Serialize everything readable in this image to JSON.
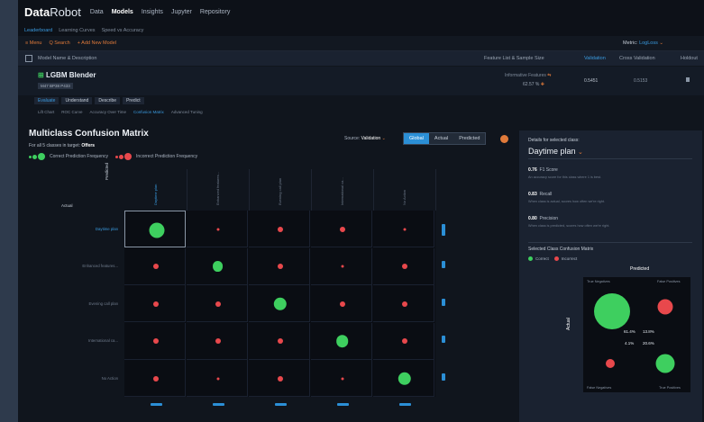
{
  "app": {
    "logo_data": "Data",
    "logo_robot": "Robot",
    "nav": [
      "Data",
      "Models",
      "Insights",
      "Jupyter",
      "Repository"
    ],
    "active_nav": "Models"
  },
  "subnav": [
    "Leaderboard",
    "Learning Curves",
    "Speed vs Accuracy"
  ],
  "actions": {
    "menu": "≡ Menu",
    "search": "Q Search",
    "add": "+ Add New Model",
    "metric_label": "Metric",
    "metric_value": "LogLoss"
  },
  "columns": {
    "model": "Model Name & Description",
    "featurelist": "Feature List & Sample Size",
    "validation": "Validation",
    "cross_validation": "Cross Validation",
    "holdout": "Holdout"
  },
  "model": {
    "name": "LGBM Blender",
    "badge": "M47  BP38 P433",
    "featurelist": "Informative Features",
    "sample_pct": "62.57 %",
    "validation": "0.5451",
    "cross_validation": "0.5153"
  },
  "tabs": [
    "Evaluate",
    "Understand",
    "Describe",
    "Predict"
  ],
  "subtabs": [
    "Lift Chart",
    "ROC Curve",
    "Accuracy Over Time",
    "Confusion Matrix",
    "Advanced Tuning"
  ],
  "matrix": {
    "title": "Multiclass Confusion Matrix",
    "subtitle_prefix": "For all 5 classes in target:",
    "target": "Offers",
    "legend_correct": "Correct Prediction Frequency",
    "legend_incorrect": "Incorrect Prediction Frequency",
    "source_label": "Source:",
    "source_value": "Validation",
    "modes": [
      "Global",
      "Actual",
      "Predicted"
    ],
    "axis_predicted": "Predicted",
    "axis_actual": "Actual",
    "classes": [
      "Daytime plan",
      "Enhanced features...",
      "Evening call plan",
      "International ca...",
      "No Action"
    ],
    "cells": [
      [
        "c",
        "ix",
        "i",
        "i",
        "ix"
      ],
      [
        "i",
        "c",
        "i",
        "ix",
        "i"
      ],
      [
        "i",
        "i",
        "c",
        "i",
        "i"
      ],
      [
        "i",
        "i",
        "i",
        "c",
        "i"
      ],
      [
        "i",
        "ix",
        "i",
        "ix",
        "c"
      ]
    ],
    "correct_scale": [
      1.0,
      0.7,
      0.85,
      0.8,
      0.85
    ]
  },
  "panel": {
    "heading": "Details for selected class:",
    "class": "Daytime plan",
    "metrics": [
      {
        "value": "0.76",
        "name": "F1 Score",
        "desc": "An accuracy score for this class where 1 is best."
      },
      {
        "value": "0.83",
        "name": "Recall",
        "desc": "When class is actual, scores how often we're right."
      },
      {
        "value": "0.80",
        "name": "Precision",
        "desc": "When class is predicted, scores how often we're right."
      }
    ],
    "cm_title": "Selected Class Confusion Matrix",
    "legend_correct": "Correct",
    "legend_incorrect": "Incorrect",
    "predicted": "Predicted",
    "actual": "Actual",
    "cm_labels": {
      "tn": "True Negatives",
      "fp": "False Positives",
      "fn": "False Negatives",
      "tp": "True Positives"
    },
    "cm_pcts": {
      "tn": "61.4%",
      "fp": "13.8%",
      "fn": "4.1%",
      "tp": "20.6%"
    }
  },
  "colors": {
    "correct": "#3ecf5f",
    "incorrect": "#e8484c",
    "accent": "#2b8fd6",
    "orange": "#e07a3a"
  }
}
